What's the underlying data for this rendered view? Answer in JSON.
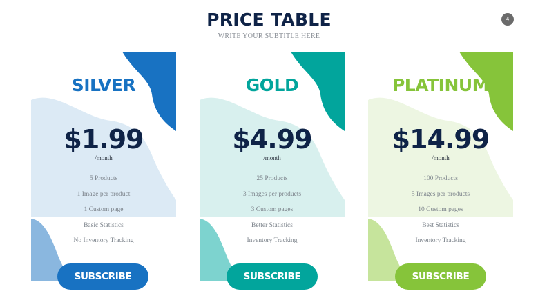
{
  "header": {
    "title": "PRICE TABLE",
    "subtitle": "WRITE YOUR SUBTITLE HERE"
  },
  "page_number": "4",
  "plans": [
    {
      "name": "SILVER",
      "price": "$1.99",
      "period": "/month",
      "features": [
        "5 Products",
        "1 Image per product",
        "1 Custom page",
        "Basic Statistics",
        "No Inventory Tracking"
      ],
      "button_label": "SUBSCRIBE",
      "accent": "#1872c2",
      "light": "#dceaf5",
      "mid": "#8ab7df"
    },
    {
      "name": "GOLD",
      "price": "$4.99",
      "period": "/month",
      "features": [
        "25 Products",
        "3 Images per products",
        "3 Custom pages",
        "Better Statistics",
        "Inventory Tracking"
      ],
      "button_label": "SUBSCRIBE",
      "accent": "#02a59c",
      "light": "#d8f0ee",
      "mid": "#7dd3cf"
    },
    {
      "name": "PLATINUM",
      "price": "$14.99",
      "period": "/month",
      "features": [
        "100 Products",
        "5 Images per products",
        "10 Custom pages",
        "Best Statistics",
        "Inventory Tracking"
      ],
      "button_label": "SUBSCRIBE",
      "accent": "#86c43a",
      "light": "#edf6e2",
      "mid": "#c6e49c"
    }
  ]
}
